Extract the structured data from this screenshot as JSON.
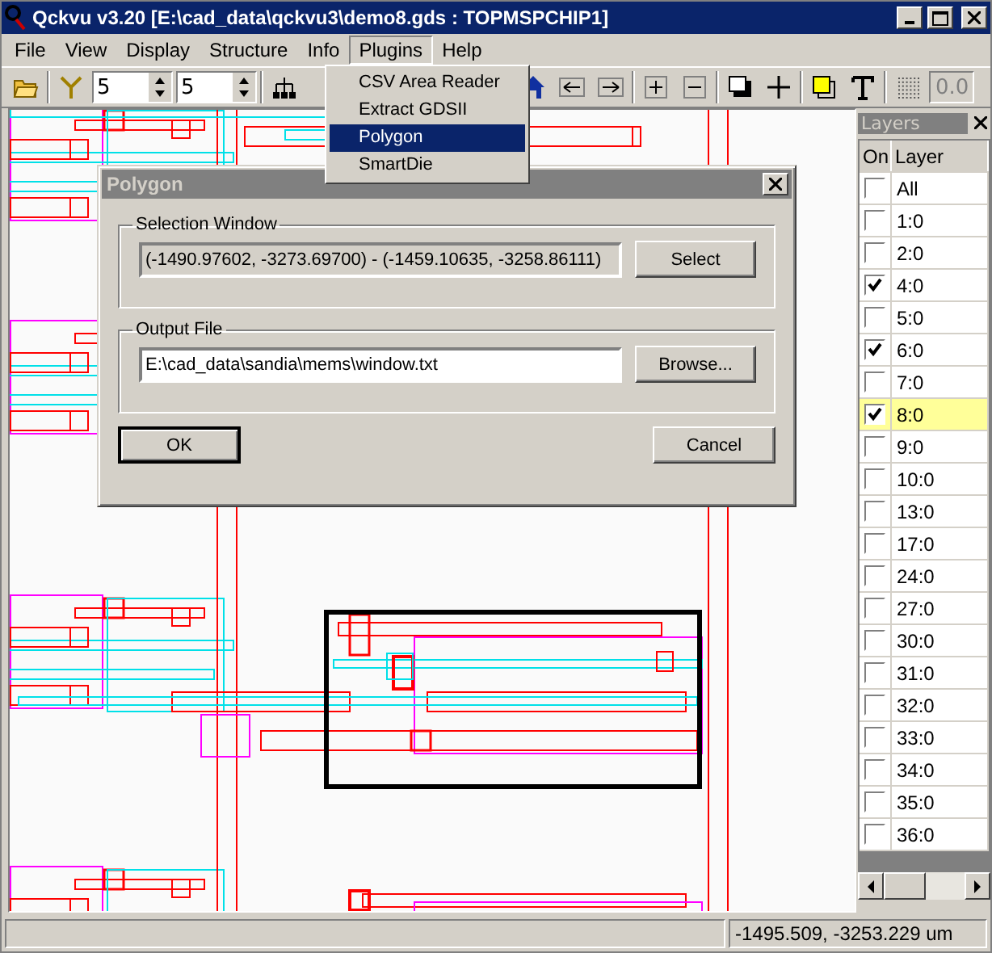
{
  "window": {
    "title": "Qckvu v3.20 [E:\\cad_data\\qckvu3\\demo8.gds : TOPMSPCHIP1]"
  },
  "menu": [
    {
      "label": "File",
      "selected": false
    },
    {
      "label": "View",
      "selected": false
    },
    {
      "label": "Display",
      "selected": false
    },
    {
      "label": "Structure",
      "selected": false
    },
    {
      "label": "Info",
      "selected": false
    },
    {
      "label": "Plugins",
      "selected": true
    },
    {
      "label": "Help",
      "selected": false
    }
  ],
  "plugins_menu": [
    {
      "label": "CSV Area Reader",
      "selected": false
    },
    {
      "label": "Extract GDSII",
      "selected": false
    },
    {
      "label": "Polygon",
      "selected": true
    },
    {
      "label": "SmartDie",
      "selected": false
    }
  ],
  "toolbar": {
    "spinners": [
      "5",
      "5"
    ],
    "zoom_field": "0.0"
  },
  "dialog": {
    "title": "Polygon",
    "selection_group": {
      "label": "Selection Window",
      "value": "(-1490.97602, -3273.69700) - (-1459.10635, -3258.86111)",
      "button": "Select"
    },
    "output_group": {
      "label": "Output File",
      "value": "E:\\cad_data\\sandia\\mems\\window.txt",
      "button": "Browse..."
    },
    "buttons": [
      "OK",
      "Cancel"
    ]
  },
  "layers": {
    "title": "Layers",
    "columns": [
      "On",
      "Layer"
    ],
    "rows": [
      {
        "name": "All",
        "checked": false,
        "selected": false
      },
      {
        "name": "1:0",
        "checked": false,
        "selected": false
      },
      {
        "name": "2:0",
        "checked": false,
        "selected": false
      },
      {
        "name": "4:0",
        "checked": true,
        "selected": false
      },
      {
        "name": "5:0",
        "checked": false,
        "selected": false
      },
      {
        "name": "6:0",
        "checked": true,
        "selected": false
      },
      {
        "name": "7:0",
        "checked": false,
        "selected": false
      },
      {
        "name": "8:0",
        "checked": true,
        "selected": true
      },
      {
        "name": "9:0",
        "checked": false,
        "selected": false
      },
      {
        "name": "10:0",
        "checked": false,
        "selected": false
      },
      {
        "name": "13:0",
        "checked": false,
        "selected": false
      },
      {
        "name": "17:0",
        "checked": false,
        "selected": false
      },
      {
        "name": "24:0",
        "checked": false,
        "selected": false
      },
      {
        "name": "27:0",
        "checked": false,
        "selected": false
      },
      {
        "name": "30:0",
        "checked": false,
        "selected": false
      },
      {
        "name": "31:0",
        "checked": false,
        "selected": false
      },
      {
        "name": "32:0",
        "checked": false,
        "selected": false
      },
      {
        "name": "33:0",
        "checked": false,
        "selected": false
      },
      {
        "name": "34:0",
        "checked": false,
        "selected": false
      },
      {
        "name": "35:0",
        "checked": false,
        "selected": false
      },
      {
        "name": "36:0",
        "checked": false,
        "selected": false
      }
    ]
  },
  "status_bar": {
    "coordinates": "-1495.509, -3253.229 um"
  }
}
